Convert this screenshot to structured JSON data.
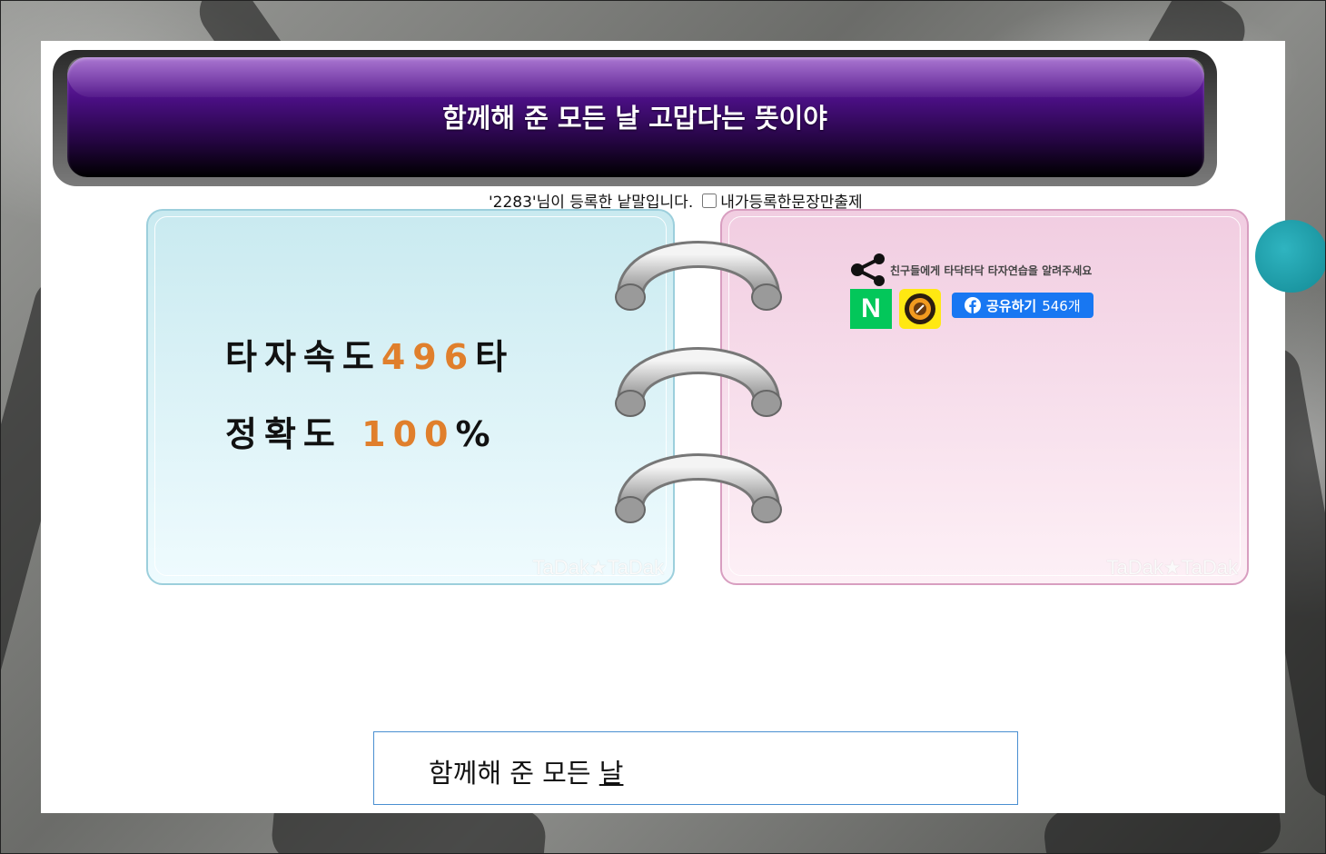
{
  "title": "함께해 준 모든 날 고맙다는 뜻이야",
  "register": {
    "text": "'2283'님이 등록한 낱말입니다.",
    "checkbox_label": "내가등록한문장만출제",
    "checked": false
  },
  "stats": {
    "speed_label": "타자속도",
    "speed_value": "496",
    "speed_unit": "타",
    "accuracy_label": "정확도",
    "accuracy_value": "100",
    "accuracy_unit": "%"
  },
  "watermark": "TaDak★TaDak",
  "share": {
    "text": "친구들에게 타닥타닥 타자연습을 알려주세요",
    "naver_label": "N",
    "facebook_label": "공유하기",
    "facebook_count": "546개"
  },
  "input": {
    "typed_main": "함께해 준 모든 ",
    "typed_current": "날"
  },
  "colors": {
    "accent_number": "#e07f2c",
    "title_purple": "#4a0f83",
    "facebook": "#1877f2",
    "naver": "#03c75a",
    "kakao": "#ffe812"
  }
}
